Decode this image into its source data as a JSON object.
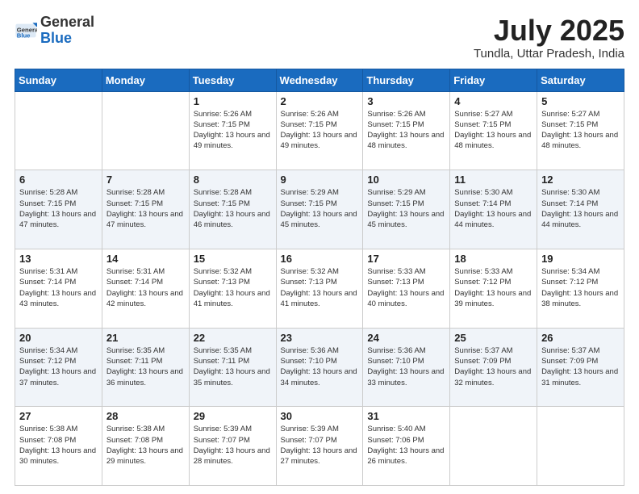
{
  "header": {
    "logo_general": "General",
    "logo_blue": "Blue",
    "month": "July 2025",
    "location": "Tundla, Uttar Pradesh, India"
  },
  "days_of_week": [
    "Sunday",
    "Monday",
    "Tuesday",
    "Wednesday",
    "Thursday",
    "Friday",
    "Saturday"
  ],
  "weeks": [
    [
      {
        "day": "",
        "info": ""
      },
      {
        "day": "",
        "info": ""
      },
      {
        "day": "1",
        "info": "Sunrise: 5:26 AM\nSunset: 7:15 PM\nDaylight: 13 hours and 49 minutes."
      },
      {
        "day": "2",
        "info": "Sunrise: 5:26 AM\nSunset: 7:15 PM\nDaylight: 13 hours and 49 minutes."
      },
      {
        "day": "3",
        "info": "Sunrise: 5:26 AM\nSunset: 7:15 PM\nDaylight: 13 hours and 48 minutes."
      },
      {
        "day": "4",
        "info": "Sunrise: 5:27 AM\nSunset: 7:15 PM\nDaylight: 13 hours and 48 minutes."
      },
      {
        "day": "5",
        "info": "Sunrise: 5:27 AM\nSunset: 7:15 PM\nDaylight: 13 hours and 48 minutes."
      }
    ],
    [
      {
        "day": "6",
        "info": "Sunrise: 5:28 AM\nSunset: 7:15 PM\nDaylight: 13 hours and 47 minutes."
      },
      {
        "day": "7",
        "info": "Sunrise: 5:28 AM\nSunset: 7:15 PM\nDaylight: 13 hours and 47 minutes."
      },
      {
        "day": "8",
        "info": "Sunrise: 5:28 AM\nSunset: 7:15 PM\nDaylight: 13 hours and 46 minutes."
      },
      {
        "day": "9",
        "info": "Sunrise: 5:29 AM\nSunset: 7:15 PM\nDaylight: 13 hours and 45 minutes."
      },
      {
        "day": "10",
        "info": "Sunrise: 5:29 AM\nSunset: 7:15 PM\nDaylight: 13 hours and 45 minutes."
      },
      {
        "day": "11",
        "info": "Sunrise: 5:30 AM\nSunset: 7:14 PM\nDaylight: 13 hours and 44 minutes."
      },
      {
        "day": "12",
        "info": "Sunrise: 5:30 AM\nSunset: 7:14 PM\nDaylight: 13 hours and 44 minutes."
      }
    ],
    [
      {
        "day": "13",
        "info": "Sunrise: 5:31 AM\nSunset: 7:14 PM\nDaylight: 13 hours and 43 minutes."
      },
      {
        "day": "14",
        "info": "Sunrise: 5:31 AM\nSunset: 7:14 PM\nDaylight: 13 hours and 42 minutes."
      },
      {
        "day": "15",
        "info": "Sunrise: 5:32 AM\nSunset: 7:13 PM\nDaylight: 13 hours and 41 minutes."
      },
      {
        "day": "16",
        "info": "Sunrise: 5:32 AM\nSunset: 7:13 PM\nDaylight: 13 hours and 41 minutes."
      },
      {
        "day": "17",
        "info": "Sunrise: 5:33 AM\nSunset: 7:13 PM\nDaylight: 13 hours and 40 minutes."
      },
      {
        "day": "18",
        "info": "Sunrise: 5:33 AM\nSunset: 7:12 PM\nDaylight: 13 hours and 39 minutes."
      },
      {
        "day": "19",
        "info": "Sunrise: 5:34 AM\nSunset: 7:12 PM\nDaylight: 13 hours and 38 minutes."
      }
    ],
    [
      {
        "day": "20",
        "info": "Sunrise: 5:34 AM\nSunset: 7:12 PM\nDaylight: 13 hours and 37 minutes."
      },
      {
        "day": "21",
        "info": "Sunrise: 5:35 AM\nSunset: 7:11 PM\nDaylight: 13 hours and 36 minutes."
      },
      {
        "day": "22",
        "info": "Sunrise: 5:35 AM\nSunset: 7:11 PM\nDaylight: 13 hours and 35 minutes."
      },
      {
        "day": "23",
        "info": "Sunrise: 5:36 AM\nSunset: 7:10 PM\nDaylight: 13 hours and 34 minutes."
      },
      {
        "day": "24",
        "info": "Sunrise: 5:36 AM\nSunset: 7:10 PM\nDaylight: 13 hours and 33 minutes."
      },
      {
        "day": "25",
        "info": "Sunrise: 5:37 AM\nSunset: 7:09 PM\nDaylight: 13 hours and 32 minutes."
      },
      {
        "day": "26",
        "info": "Sunrise: 5:37 AM\nSunset: 7:09 PM\nDaylight: 13 hours and 31 minutes."
      }
    ],
    [
      {
        "day": "27",
        "info": "Sunrise: 5:38 AM\nSunset: 7:08 PM\nDaylight: 13 hours and 30 minutes."
      },
      {
        "day": "28",
        "info": "Sunrise: 5:38 AM\nSunset: 7:08 PM\nDaylight: 13 hours and 29 minutes."
      },
      {
        "day": "29",
        "info": "Sunrise: 5:39 AM\nSunset: 7:07 PM\nDaylight: 13 hours and 28 minutes."
      },
      {
        "day": "30",
        "info": "Sunrise: 5:39 AM\nSunset: 7:07 PM\nDaylight: 13 hours and 27 minutes."
      },
      {
        "day": "31",
        "info": "Sunrise: 5:40 AM\nSunset: 7:06 PM\nDaylight: 13 hours and 26 minutes."
      },
      {
        "day": "",
        "info": ""
      },
      {
        "day": "",
        "info": ""
      }
    ]
  ]
}
